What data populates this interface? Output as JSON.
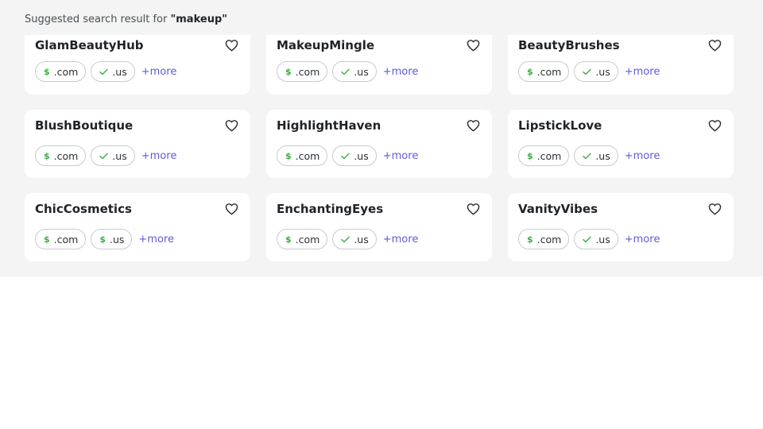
{
  "search": {
    "prefix": "Suggested search result for ",
    "term": "\"makeup\""
  },
  "icons": {
    "heart": "heart-outline-icon",
    "dollar": "dollar-icon",
    "check": "check-icon"
  },
  "colors": {
    "accent": "#5f5bd8",
    "status_green": "#3fae4a",
    "panel_bg": "#f3f4f3"
  },
  "cards": [
    {
      "name": "GlamBeautyHub",
      "chips": [
        {
          "icon": "dollar",
          "label": ".com"
        },
        {
          "icon": "check",
          "label": ".us"
        }
      ],
      "more": "+more"
    },
    {
      "name": "MakeupMingle",
      "chips": [
        {
          "icon": "dollar",
          "label": ".com"
        },
        {
          "icon": "check",
          "label": ".us"
        }
      ],
      "more": "+more"
    },
    {
      "name": "BeautyBrushes",
      "chips": [
        {
          "icon": "dollar",
          "label": ".com"
        },
        {
          "icon": "check",
          "label": ".us"
        }
      ],
      "more": "+more"
    },
    {
      "name": "BlushBoutique",
      "chips": [
        {
          "icon": "dollar",
          "label": ".com"
        },
        {
          "icon": "check",
          "label": ".us"
        }
      ],
      "more": "+more"
    },
    {
      "name": "HighlightHaven",
      "chips": [
        {
          "icon": "dollar",
          "label": ".com"
        },
        {
          "icon": "check",
          "label": ".us"
        }
      ],
      "more": "+more"
    },
    {
      "name": "LipstickLove",
      "chips": [
        {
          "icon": "dollar",
          "label": ".com"
        },
        {
          "icon": "check",
          "label": ".us"
        }
      ],
      "more": "+more"
    },
    {
      "name": "ChicCosmetics",
      "chips": [
        {
          "icon": "dollar",
          "label": ".com"
        },
        {
          "icon": "dollar",
          "label": ".us"
        }
      ],
      "more": "+more"
    },
    {
      "name": "EnchantingEyes",
      "chips": [
        {
          "icon": "dollar",
          "label": ".com"
        },
        {
          "icon": "check",
          "label": ".us"
        }
      ],
      "more": "+more"
    },
    {
      "name": "VanityVibes",
      "chips": [
        {
          "icon": "dollar",
          "label": ".com"
        },
        {
          "icon": "check",
          "label": ".us"
        }
      ],
      "more": "+more"
    }
  ]
}
